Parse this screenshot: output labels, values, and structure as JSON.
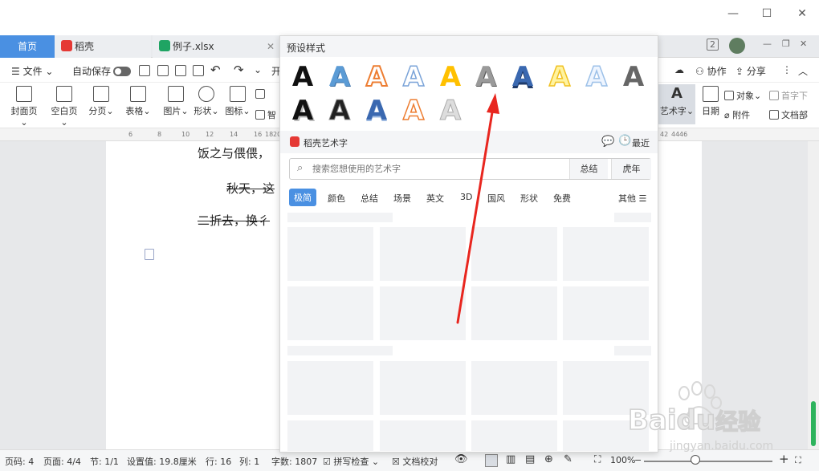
{
  "tabs": {
    "home": "首页",
    "daoke": "稻壳",
    "file": "例子.xlsx",
    "badge": "2"
  },
  "menu": {
    "file": "文件",
    "autosave": "自动保存",
    "open_partial": "开",
    "cooperate": "协作",
    "share": "分享"
  },
  "ribbon": {
    "cover": "封面页",
    "blank": "空白页",
    "pagebreak": "分页",
    "table": "表格",
    "picture": "图片",
    "shape": "形状",
    "icon": "图标",
    "smart_partial": "智",
    "wordart": "艺术字",
    "date": "日期",
    "object": "对象",
    "attachment": "附件",
    "dropcap": "首字下",
    "docpart": "文档部"
  },
  "ruler": {
    "marks": [
      "6",
      "8",
      "10",
      "12",
      "14",
      "16",
      "18",
      "20",
      "42",
      "44",
      "46"
    ]
  },
  "document": {
    "line1": "饭之与偎偎，",
    "line2": "秋天，这",
    "line3": "二折去，换彳"
  },
  "popup": {
    "title": "预设样式",
    "section": "稻壳艺术字",
    "recent": "最近",
    "search_placeholder": "搜索您想使用的艺术字",
    "tag1": "总结",
    "tag2": "虎年",
    "categories": [
      "极简",
      "颜色",
      "总结",
      "场景",
      "英文",
      "3D",
      "国风",
      "形状",
      "免费"
    ],
    "more": "其他",
    "art_letter": "A"
  },
  "status": {
    "page_code": "页码: 4",
    "pages": "页面: 4/4",
    "section": "节: 1/1",
    "setting": "设置值: 19.8厘米",
    "row": "行: 16",
    "col": "列: 1",
    "words": "字数: 1807",
    "spell": "拼写检查",
    "proof": "文档校对",
    "zoom": "100%"
  },
  "watermark": {
    "brand": "Bai",
    "brand2": "du",
    "cn": "经验",
    "url": "jingyan.baidu.com"
  },
  "colors": {
    "accent": "#4a90e2",
    "arrow": "#e8261f",
    "green": "#2db35d"
  }
}
